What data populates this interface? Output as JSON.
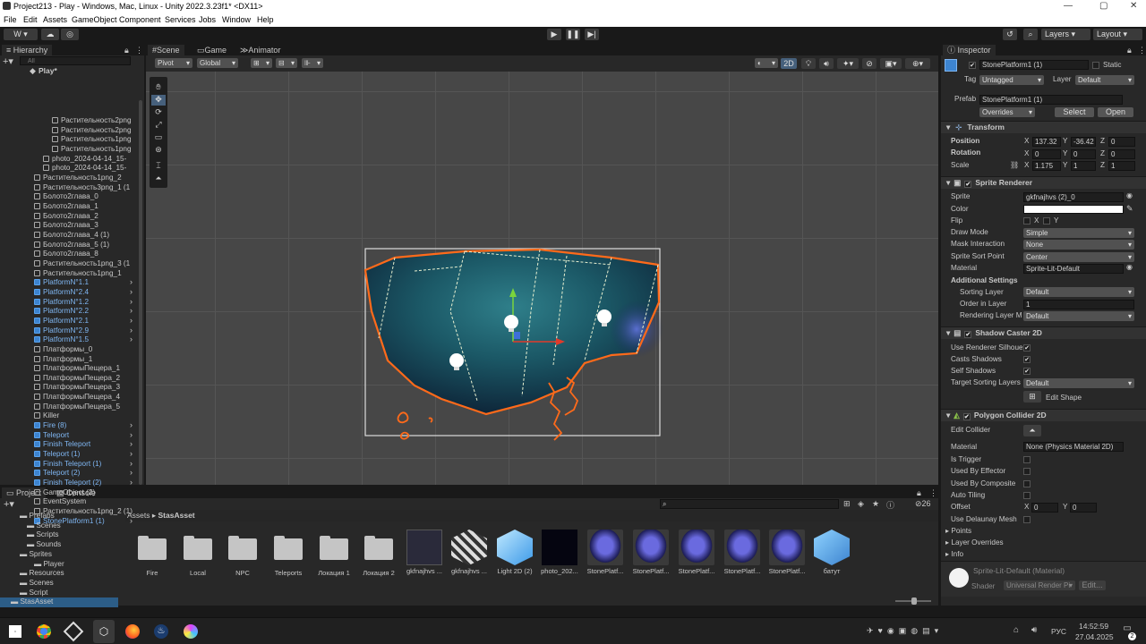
{
  "window": {
    "title": "Project213 - Play - Windows, Mac, Linux - Unity 2022.3.23f1* <DX11>"
  },
  "menu": [
    "File",
    "Edit",
    "Assets",
    "GameObject",
    "Component",
    "Services",
    "Jobs",
    "Window",
    "Help"
  ],
  "toolbar": {
    "account": "W",
    "layers": "Layers",
    "layout": "Layout"
  },
  "hierarchy": {
    "tab": "Hierarchy",
    "search_placeholder": "All",
    "scene": "Play*",
    "items": [
      {
        "label": "Растительность2png",
        "prefab": false
      },
      {
        "label": "Растительность2png",
        "prefab": false
      },
      {
        "label": "Растительность1png",
        "prefab": false
      },
      {
        "label": "Растительность1png",
        "prefab": false
      },
      {
        "label": "photo_2024-04-14_15-",
        "prefab": false
      },
      {
        "label": "photo_2024-04-14_15-",
        "prefab": false
      },
      {
        "label": "Растительность1png_2",
        "prefab": false
      },
      {
        "label": "Растительность3png_1 (1",
        "prefab": false
      },
      {
        "label": "Болото2глава_0",
        "prefab": false
      },
      {
        "label": "Болото2глава_1",
        "prefab": false
      },
      {
        "label": "Болото2глава_2",
        "prefab": false
      },
      {
        "label": "Болото2глава_3",
        "prefab": false
      },
      {
        "label": "Болото2глава_4 (1)",
        "prefab": false
      },
      {
        "label": "Болото2глава_5 (1)",
        "prefab": false
      },
      {
        "label": "Болото2глава_8",
        "prefab": false
      },
      {
        "label": "Растительность1png_3 (1",
        "prefab": false
      },
      {
        "label": "Растительность1png_1",
        "prefab": false
      },
      {
        "label": "PlatformN°1.1",
        "prefab": true
      },
      {
        "label": "PlatformN°2.4",
        "prefab": true
      },
      {
        "label": "PlatformN°1.2",
        "prefab": true
      },
      {
        "label": "PlatformN°2.2",
        "prefab": true
      },
      {
        "label": "PlatformN°2.1",
        "prefab": true
      },
      {
        "label": "PlatformN°2.9",
        "prefab": true
      },
      {
        "label": "PlatformN°1.5",
        "prefab": true
      },
      {
        "label": "Платформы_0",
        "prefab": false
      },
      {
        "label": "Платформы_1",
        "prefab": false
      },
      {
        "label": "ПлатформыПещера_1",
        "prefab": false
      },
      {
        "label": "ПлатформыПещера_2",
        "prefab": false
      },
      {
        "label": "ПлатформыПещера_3",
        "prefab": false
      },
      {
        "label": "ПлатформыПещера_4",
        "prefab": false
      },
      {
        "label": "ПлатформыПещера_5",
        "prefab": false
      },
      {
        "label": "Killer",
        "prefab": false
      },
      {
        "label": "Fire (8)",
        "prefab": true
      },
      {
        "label": "Teleport",
        "prefab": true
      },
      {
        "label": "Finish Teleport",
        "prefab": true
      },
      {
        "label": "Teleport (1)",
        "prefab": true
      },
      {
        "label": "Finish Teleport (1)",
        "prefab": true
      },
      {
        "label": "Teleport (2)",
        "prefab": true
      },
      {
        "label": "Finish Teleport (2)",
        "prefab": true
      },
      {
        "label": "GameObject (2)",
        "prefab": false
      },
      {
        "label": "EventSystem",
        "prefab": false
      },
      {
        "label": "Растительность1png_2 (1)",
        "prefab": false
      },
      {
        "label": "StonePlatform1 (1)",
        "prefab": true
      }
    ]
  },
  "scene_view": {
    "tabs": [
      "Scene",
      "Game",
      "Animator"
    ],
    "pivot": "Pivot",
    "global": "Global",
    "mode_2d": "2D"
  },
  "inspector": {
    "tab": "Inspector",
    "object_name": "StonePlatform1 (1)",
    "static_label": "Static",
    "tag_label": "Tag",
    "tag_value": "Untagged",
    "layer_label": "Layer",
    "layer_value": "Default",
    "prefab_label": "Prefab",
    "prefab_value": "StonePlatform1 (1)",
    "overrides": "Overrides",
    "select": "Select",
    "open": "Open",
    "transform": {
      "title": "Transform",
      "position_label": "Position",
      "rotation_label": "Rotation",
      "scale_label": "Scale",
      "position": [
        "137.32",
        "-36.42",
        "0"
      ],
      "rotation": [
        "0",
        "0",
        "0"
      ],
      "scale": [
        "1.175",
        "1",
        "1"
      ]
    },
    "sprite_renderer": {
      "title": "Sprite Renderer",
      "rows": [
        {
          "label": "Sprite",
          "value": "gkfnajhvs (2)_0"
        },
        {
          "label": "Color",
          "value": ""
        },
        {
          "label": "Flip",
          "value": ""
        },
        {
          "label": "Draw Mode",
          "value": "Simple"
        },
        {
          "label": "Mask Interaction",
          "value": "None"
        },
        {
          "label": "Sprite Sort Point",
          "value": "Center"
        },
        {
          "label": "Material",
          "value": "Sprite-Lit-Default"
        }
      ],
      "additional": "Additional Settings",
      "sorting_layer_label": "Sorting Layer",
      "sorting_layer": "Default",
      "order_label": "Order in Layer",
      "order": "1",
      "rendering_label": "Rendering Layer M",
      "rendering": "Default"
    },
    "shadow_caster": {
      "title": "Shadow Caster 2D",
      "use_renderer": "Use Renderer Silhoue",
      "casts": "Casts Shadows",
      "self": "Self Shadows",
      "target_label": "Target Sorting Layers",
      "target": "Default",
      "edit_shape": "Edit Shape"
    },
    "polygon_collider": {
      "title": "Polygon Collider 2D",
      "edit_collider": "Edit Collider",
      "material_label": "Material",
      "material": "None (Physics Material 2D)",
      "is_trigger": "Is Trigger",
      "used_by_effector": "Used By Effector",
      "used_by_composite": "Used By Composite",
      "auto_tiling": "Auto Tiling",
      "offset_label": "Offset",
      "offset": [
        "0",
        "0"
      ],
      "delaunay": "Use Delaunay Mesh",
      "points": "Points",
      "layer_overrides": "Layer Overrides",
      "info": "Info"
    },
    "material_footer": {
      "name": "Sprite-Lit-Default (Material)",
      "shader_label": "Shader",
      "shader": "Universal Render Pi",
      "edit": "Edit..."
    }
  },
  "project": {
    "tabs": [
      "Project",
      "Console"
    ],
    "tree": [
      "Prefabs",
      "Scenes",
      "Scripts",
      "Sounds",
      "Sprites",
      "Player",
      "Resources",
      "Scenes",
      "Script",
      "StasAsset"
    ],
    "breadcrumb": [
      "Assets",
      "StasAsset"
    ],
    "count": "26",
    "assets": [
      "Fire",
      "Local",
      "NPC",
      "Teleports",
      "Локация 1",
      "Локация 2",
      "gkfnajhvs ...",
      "gkfnajhvs ...",
      "Light 2D (2)",
      "photo_202...",
      "StonePlatf...",
      "StonePlatf...",
      "StonePlatf...",
      "StonePlatf...",
      "StonePlatf...",
      "батут"
    ]
  },
  "taskbar": {
    "lang": "РУС",
    "time": "14:52:59",
    "date": "27.04.2025",
    "notif": "2"
  }
}
